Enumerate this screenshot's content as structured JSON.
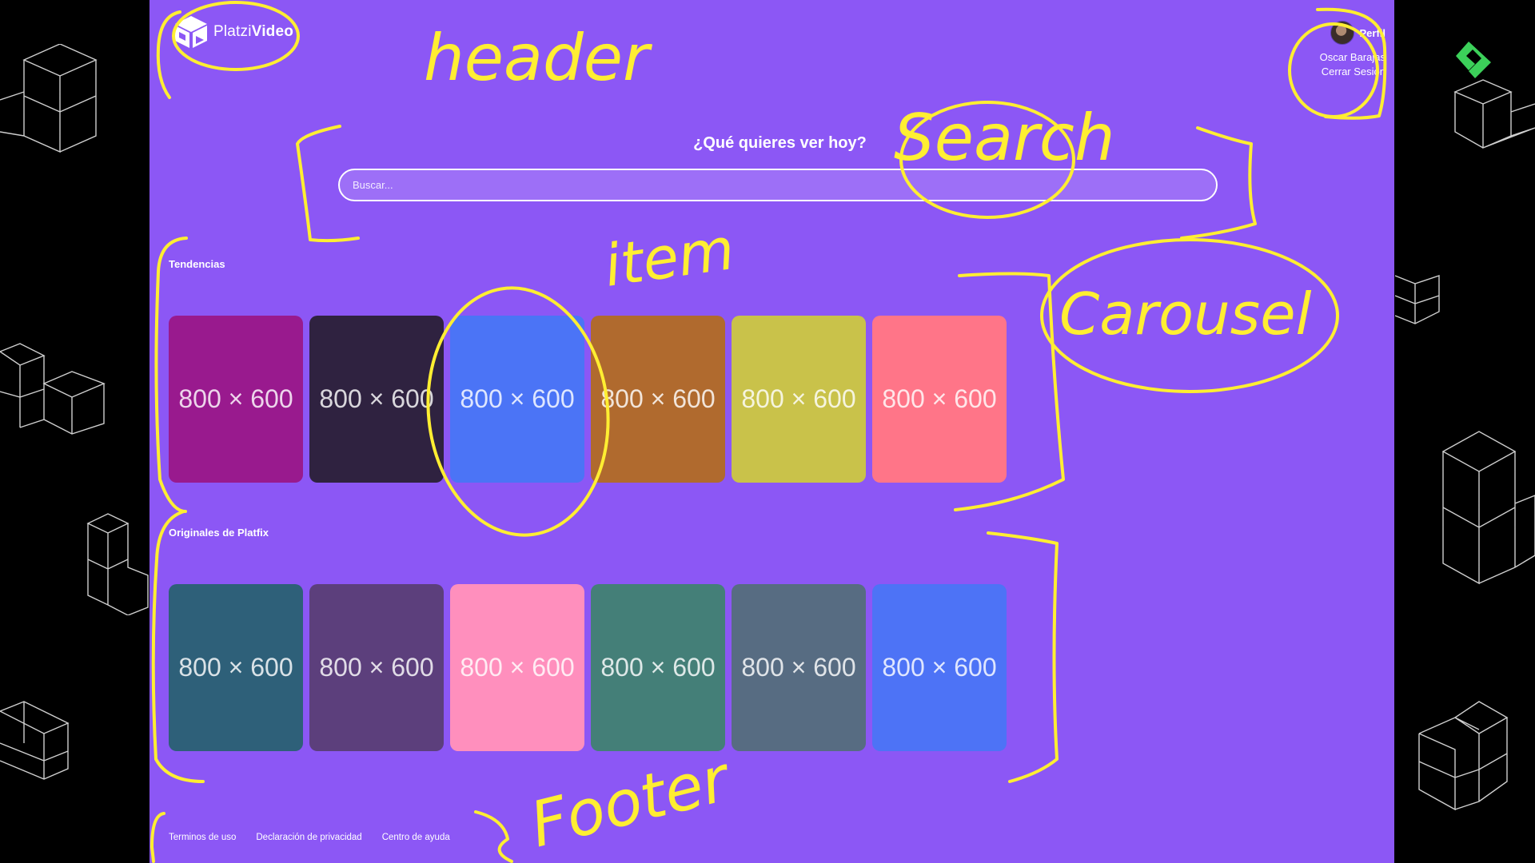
{
  "header": {
    "logo": {
      "prefix": "Platzi",
      "suffix": "Video"
    },
    "profile": {
      "name": "Perfil",
      "menu": [
        "Oscar Barajas",
        "Cerrar Sesión"
      ]
    }
  },
  "search": {
    "title": "¿Qué quieres ver hoy?",
    "placeholder": "Buscar..."
  },
  "carousels": [
    {
      "title": "Tendencias",
      "items": [
        {
          "label": "800 × 600",
          "color": "#991a8e"
        },
        {
          "label": "800 × 600",
          "color": "#2f2240"
        },
        {
          "label": "800 × 600",
          "color": "#4b74f6"
        },
        {
          "label": "800 × 600",
          "color": "#b06a2e"
        },
        {
          "label": "800 × 600",
          "color": "#c9c24a"
        },
        {
          "label": "800 × 600",
          "color": "#ff7588"
        }
      ]
    },
    {
      "title": "Originales de Platfix",
      "items": [
        {
          "label": "800 × 600",
          "color": "#2e6079"
        },
        {
          "label": "800 × 600",
          "color": "#5c3f7c"
        },
        {
          "label": "800 × 600",
          "color": "#ff8fbd"
        },
        {
          "label": "800 × 600",
          "color": "#447f78"
        },
        {
          "label": "800 × 600",
          "color": "#576c82"
        },
        {
          "label": "800 × 600",
          "color": "#4d73f6"
        }
      ]
    }
  ],
  "footer": {
    "links": [
      "Terminos de uso",
      "Declaración de privacidad",
      "Centro de ayuda"
    ]
  },
  "annotations": {
    "header": "header",
    "search": "Search",
    "item": "item",
    "carousel": "Carousel",
    "footer": "Footer"
  },
  "colors": {
    "app_background": "#8c57f5",
    "annotation": "#ffee32",
    "brand_glyph": "#3cd05a"
  }
}
